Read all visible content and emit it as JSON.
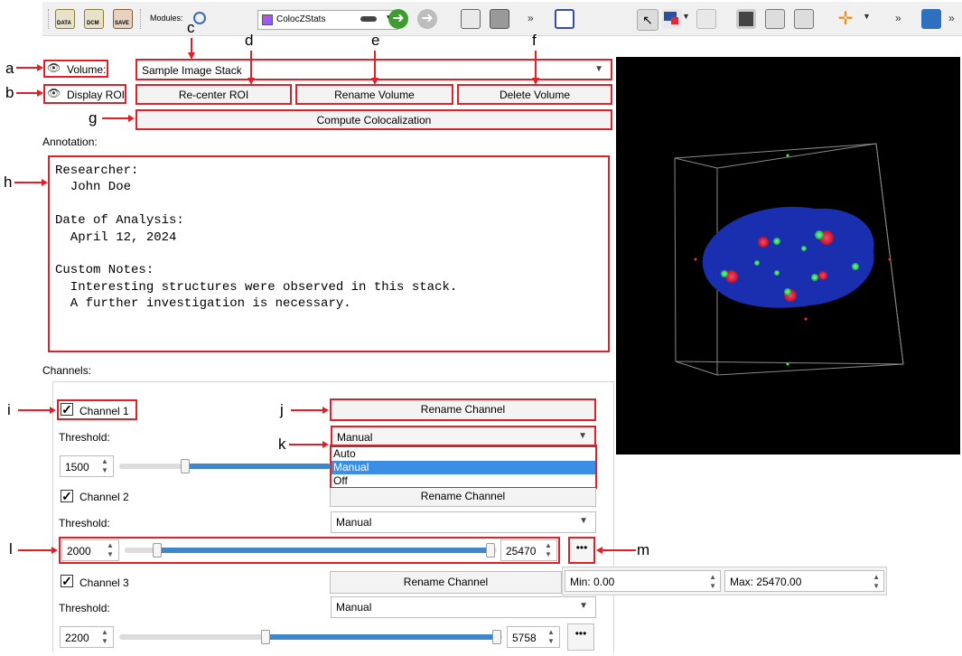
{
  "toolbar": {
    "data_label": "DATA",
    "dcm_label": "DCM",
    "save_label": "SAVE",
    "modules_label": "Modules:",
    "module_selected": "ColocZStats"
  },
  "volume": {
    "label": "Volume:",
    "selected": "Sample Image Stack"
  },
  "display_roi_label": "Display ROI",
  "buttons": {
    "recenter_roi": "Re-center ROI",
    "rename_volume": "Rename Volume",
    "delete_volume": "Delete Volume",
    "compute_colocalization": "Compute Colocalization"
  },
  "annotation": {
    "label": "Annotation:",
    "text": "Researcher:\n  John Doe\n\nDate of Analysis:\n  April 12, 2024\n\nCustom Notes:\n  Interesting structures were observed in this stack.\n  A further investigation is necessary."
  },
  "channels_label": "Channels:",
  "threshold_label": "Threshold:",
  "rename_channel_label": "Rename Channel",
  "dots_label": "•••",
  "channel1": {
    "name": "Channel 1",
    "threshold_mode": "Manual",
    "min_value": "1500"
  },
  "channel2": {
    "name": "Channel 2",
    "threshold_mode": "Manual",
    "min_value": "2000",
    "max_value": "25470"
  },
  "channel3": {
    "name": "Channel 3",
    "threshold_mode": "Manual",
    "min_value": "2200",
    "max_value": "5758"
  },
  "threshold_options": [
    "Auto",
    "Manual",
    "Off"
  ],
  "range_popup": {
    "min": "Min: 0.00",
    "max": "Max: 25470.00"
  },
  "callouts": {
    "a": "a",
    "b": "b",
    "c": "c",
    "d": "d",
    "e": "e",
    "f": "f",
    "g": "g",
    "h": "h",
    "i": "i",
    "j": "j",
    "k": "k",
    "l": "l",
    "m": "m"
  },
  "colors": {
    "accent_red": "#e41e26",
    "selection_blue": "#3a8ee6",
    "slider_blue": "#3f87c8"
  }
}
